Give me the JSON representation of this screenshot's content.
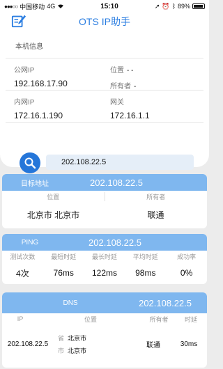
{
  "status": {
    "carrier": "中国移动",
    "network": "4G",
    "time": "15:10",
    "battery": "89%"
  },
  "nav": {
    "title": "OTS IP助手",
    "edit_icon": "edit-icon"
  },
  "local_info": {
    "heading": "本机信息",
    "public_ip_label": "公网IP",
    "public_ip": "192.168.17.90",
    "location_label": "位置",
    "location_value": "- -",
    "owner_label": "所有者",
    "owner_value": "-",
    "intranet_ip_label": "内网IP",
    "intranet_ip": "172.16.1.190",
    "gateway_label": "网关",
    "gateway": "172.16.1.1"
  },
  "search": {
    "query": "202.108.22.5",
    "icon": "search-icon"
  },
  "target": {
    "label": "目标地址",
    "ip": "202.108.22.5",
    "location_header": "位置",
    "owner_header": "所有者",
    "location": "北京市 北京市",
    "owner": "联通"
  },
  "ping": {
    "label": "PING",
    "ip": "202.108.22.5",
    "headers": [
      "测试次数",
      "最短时延",
      "最长时延",
      "平均时延",
      "成功率"
    ],
    "values": [
      "4次",
      "76ms",
      "122ms",
      "98ms",
      "0%"
    ]
  },
  "dns": {
    "label": "DNS",
    "ip": "202.108.22.5",
    "headers": {
      "ip": "IP",
      "location": "位置",
      "owner": "所有者",
      "ttl": "时延"
    },
    "row": {
      "ip": "202.108.22.5",
      "province_tag": "省",
      "province": "北京市",
      "city_tag": "市",
      "city": "北京市",
      "owner": "联通",
      "ttl": "30ms"
    }
  }
}
